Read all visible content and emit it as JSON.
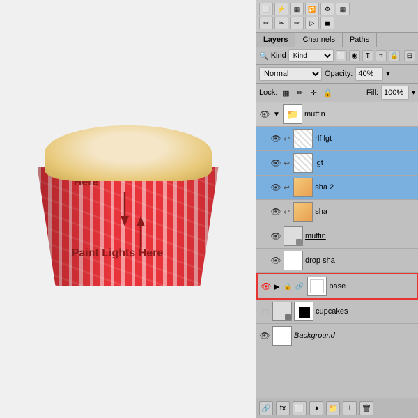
{
  "canvas": {
    "annotation_shadows": "Paint Shadows Here",
    "annotation_lights": "Paint Lights Here"
  },
  "panel": {
    "title": "Layers",
    "tabs": [
      "Layers",
      "Channels",
      "Paths"
    ],
    "active_tab": "Layers",
    "filter_label": "Kind",
    "blend_mode": "Normal",
    "opacity_label": "Opacity:",
    "opacity_value": "40%",
    "lock_label": "Lock:",
    "fill_label": "Fill:",
    "fill_value": "100%",
    "layers": [
      {
        "id": "muffin-group",
        "name": "muffin",
        "type": "group",
        "visible": true,
        "selected": false,
        "indent": 0
      },
      {
        "id": "rlf-lgt",
        "name": "rlf lgt",
        "type": "layer",
        "visible": true,
        "selected": true,
        "indent": 1
      },
      {
        "id": "lgt",
        "name": "lgt",
        "type": "layer",
        "visible": true,
        "selected": true,
        "indent": 1
      },
      {
        "id": "sha2",
        "name": "sha 2",
        "type": "layer",
        "visible": true,
        "selected": true,
        "indent": 1
      },
      {
        "id": "sha",
        "name": "sha",
        "type": "layer",
        "visible": true,
        "selected": false,
        "indent": 1
      },
      {
        "id": "muffin-layer",
        "name": "muffin",
        "type": "smart",
        "visible": true,
        "selected": false,
        "indent": 1
      },
      {
        "id": "drop-sha",
        "name": "drop sha",
        "type": "layer",
        "visible": true,
        "selected": false,
        "indent": 1
      },
      {
        "id": "base",
        "name": "base",
        "type": "mask",
        "visible": false,
        "selected": false,
        "indent": 0,
        "red": true
      },
      {
        "id": "cupcakes",
        "name": "cupcakes",
        "type": "smart-group",
        "visible": false,
        "selected": false,
        "indent": 0
      },
      {
        "id": "background",
        "name": "Background",
        "type": "background",
        "visible": true,
        "selected": false,
        "indent": 0
      }
    ]
  },
  "toolbar": {
    "icons": [
      "⬜",
      "✂",
      "✏",
      "▦",
      "🔒",
      "◉",
      "T",
      "⌗",
      "🔗"
    ]
  }
}
